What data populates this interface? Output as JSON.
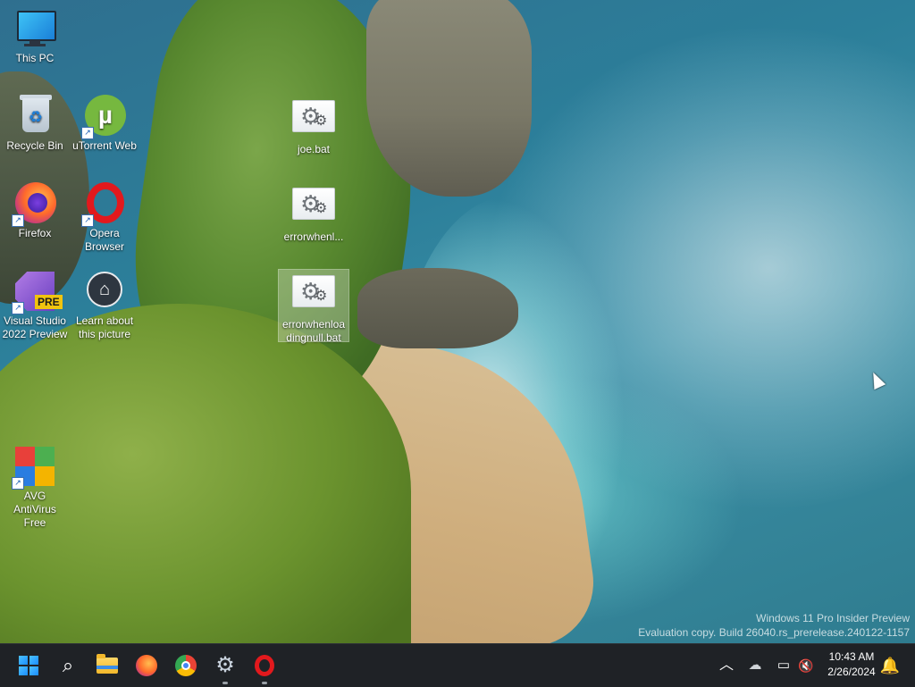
{
  "desktop": {
    "icons": [
      {
        "id": "this-pc",
        "label": "This PC"
      },
      {
        "id": "recycle-bin",
        "label": "Recycle Bin"
      },
      {
        "id": "utorrent",
        "label": "uTorrent Web"
      },
      {
        "id": "firefox",
        "label": "Firefox"
      },
      {
        "id": "opera",
        "label": "Opera Browser"
      },
      {
        "id": "vs",
        "label": "Visual Studio 2022 Preview",
        "badge": "PRE"
      },
      {
        "id": "learn",
        "label": "Learn about this picture"
      },
      {
        "id": "avg",
        "label": "AVG AntiVirus Free"
      },
      {
        "id": "joe",
        "label": "joe.bat"
      },
      {
        "id": "error1",
        "label": "errorwhenl..."
      },
      {
        "id": "error2",
        "label": "errorwhenloadingnull.bat"
      }
    ]
  },
  "watermark": {
    "line1": "Windows 11 Pro Insider Preview",
    "line2": "Evaluation copy. Build 26040.rs_prerelease.240122-1157"
  },
  "taskbar": {
    "clock_time": "10:43 AM",
    "clock_date": "2/26/2024",
    "colors": {
      "accent": "#4cc2ff",
      "background": "#1f2226"
    },
    "pinned_icons": [
      "windows-start",
      "search",
      "file-explorer",
      "firefox",
      "chrome",
      "settings",
      "opera"
    ],
    "tray_icons": [
      "chevron-up",
      "onedrive-offline",
      "network",
      "speaker-muted",
      "notification-bell"
    ]
  }
}
